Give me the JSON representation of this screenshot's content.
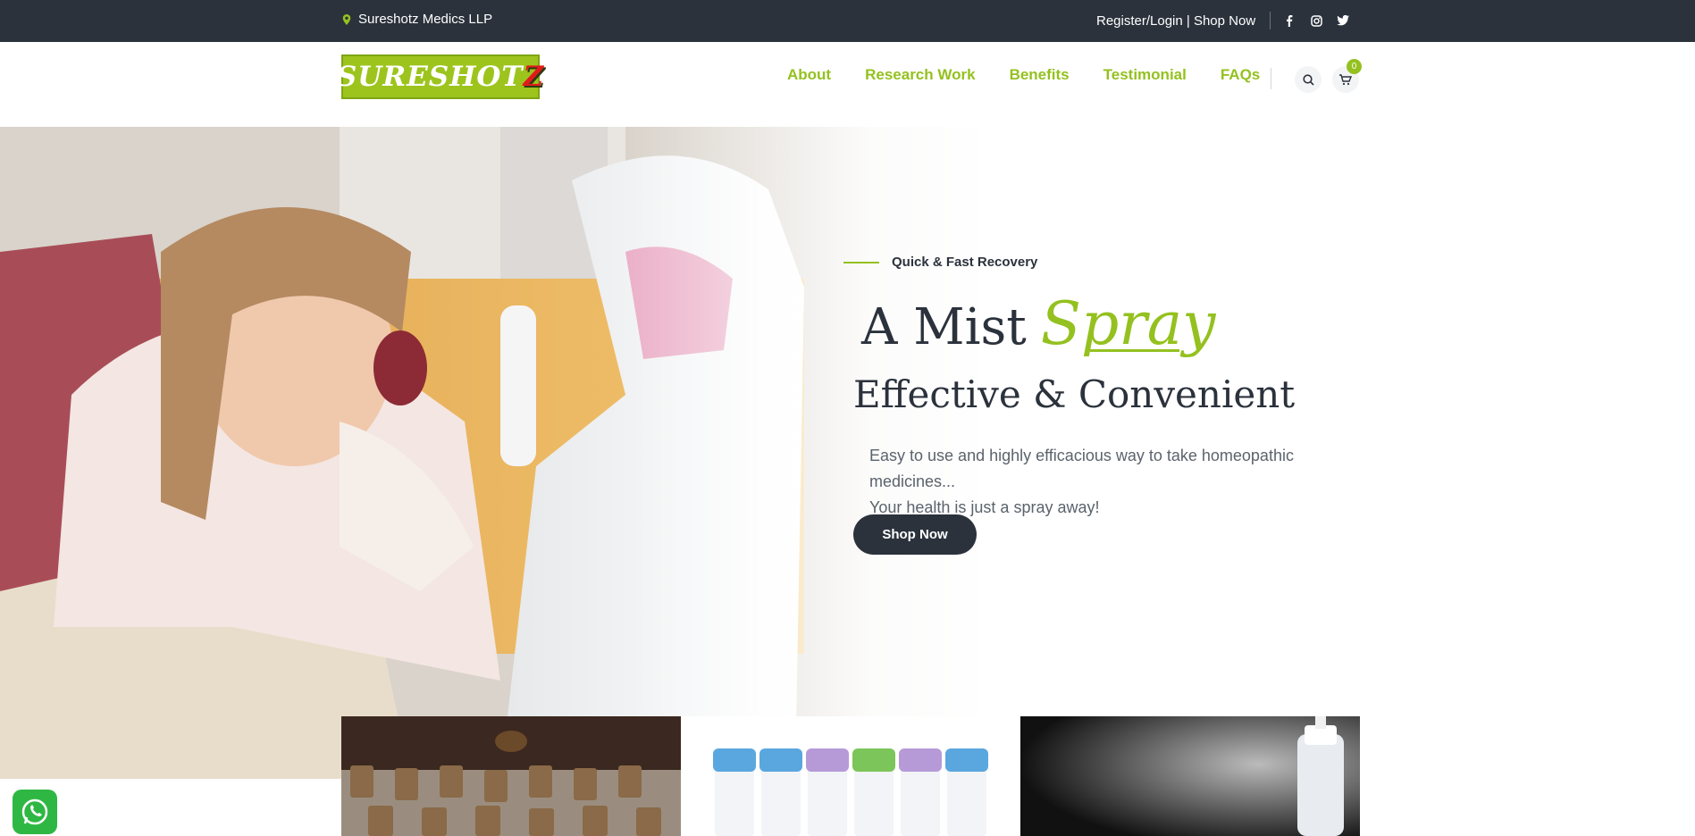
{
  "topbar": {
    "company": "Sureshotz Medics LLP",
    "links_text": "Register/Login | Shop Now",
    "social": [
      "facebook-icon",
      "instagram-icon",
      "twitter-icon"
    ]
  },
  "header": {
    "logo_main": "SURESHOT",
    "logo_tail": "Z",
    "nav": [
      "About",
      "Research Work",
      "Benefits",
      "Testimonial",
      "FAQs"
    ],
    "cart_count": "0"
  },
  "hero": {
    "kicker": "Quick & Fast Recovery",
    "title_main": "A Mist",
    "title_accent": "Spray",
    "subtitle": "Effective & Convenient",
    "desc_line1": "Easy to use and highly efficacious way to take homeopathic medicines...",
    "desc_line2": "Your health is just a spray away!",
    "cta": "Shop Now"
  },
  "colors": {
    "accent": "#94c11f",
    "dark": "#2b323c",
    "whatsapp": "#2fb744"
  }
}
